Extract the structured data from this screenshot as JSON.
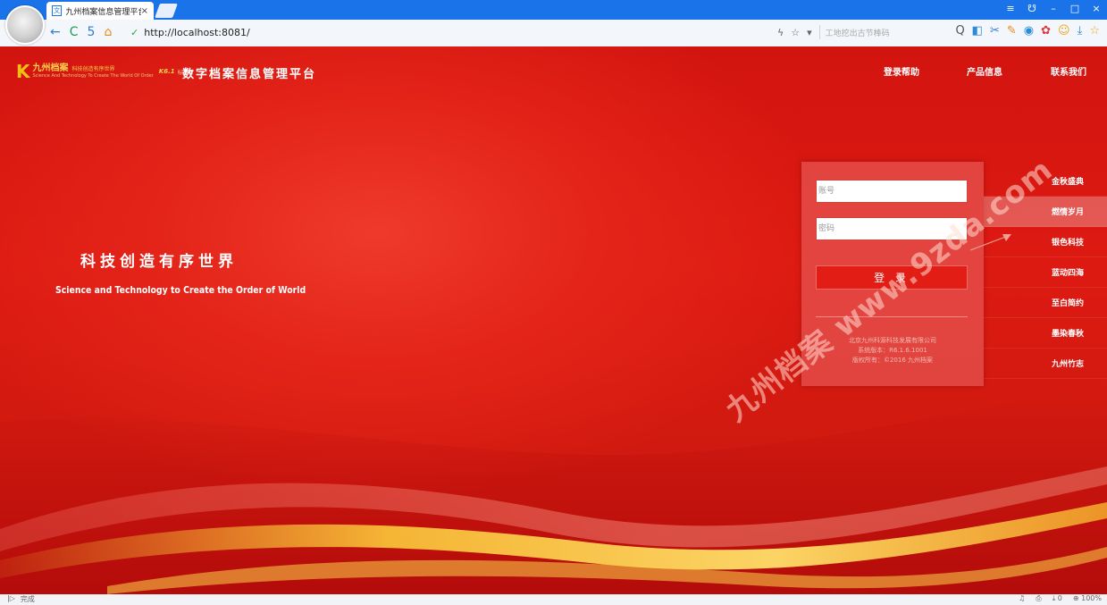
{
  "browser": {
    "tab_title": "九州档案信息管理平台",
    "tab_close": "×",
    "favicon": "文",
    "url": "http://localhost:8081/",
    "search_hint": "工地挖出古节棒码",
    "status_text": "完成",
    "zoom": "100%",
    "download_count": "0",
    "icons": {
      "back": "←",
      "reload": "C",
      "undo": "5",
      "home": "⌂",
      "shield": "✓",
      "lightning": "ϟ",
      "star": "☆",
      "dropdown": "▾",
      "search": "Q",
      "menu": "≡",
      "skin": "☋",
      "minimize": "–",
      "maximize": "□",
      "close": "×",
      "status_play": "|▷",
      "sound": "♫",
      "print": "⎙",
      "download": "⤓",
      "zoom_icon": "⊕"
    }
  },
  "header": {
    "logo_k": "K",
    "logo_name": "九州档案",
    "logo_sub": "科技创造有序世界",
    "logo_slogan": "Science And Technology To Create The World Of Order",
    "logo_version": "K6.1",
    "logo_edition": "标准版",
    "platform_title": "数字档案信息管理平台"
  },
  "nav": {
    "login_help": "登录帮助",
    "product_info": "产品信息",
    "contact_us": "联系我们"
  },
  "hero": {
    "slogan_cn": "科技创造有序世界",
    "slogan_en": "Science and Technology to Create the Order of World"
  },
  "login": {
    "account_placeholder": "账号",
    "password_placeholder": "密码",
    "submit_label": "登 录",
    "company": "北京九州科源科技发展有限公司",
    "version": "系统版本：R6.1.6.1001",
    "copyright": "版权所有：©2016 九州档案"
  },
  "side_menu": [
    {
      "label": "金秋盛典",
      "active": false
    },
    {
      "label": "燃情岁月",
      "active": true
    },
    {
      "label": "银色科技",
      "active": false
    },
    {
      "label": "蓝动四海",
      "active": false
    },
    {
      "label": "至白简约",
      "active": false
    },
    {
      "label": "墨染春秋",
      "active": false
    },
    {
      "label": "九州竹志",
      "active": false
    }
  ],
  "watermark": "九州档案 www.9zda.com",
  "colors": {
    "brand_red": "#d8170f",
    "accent_gold": "#f2c015",
    "browser_blue": "#1a73e8"
  }
}
